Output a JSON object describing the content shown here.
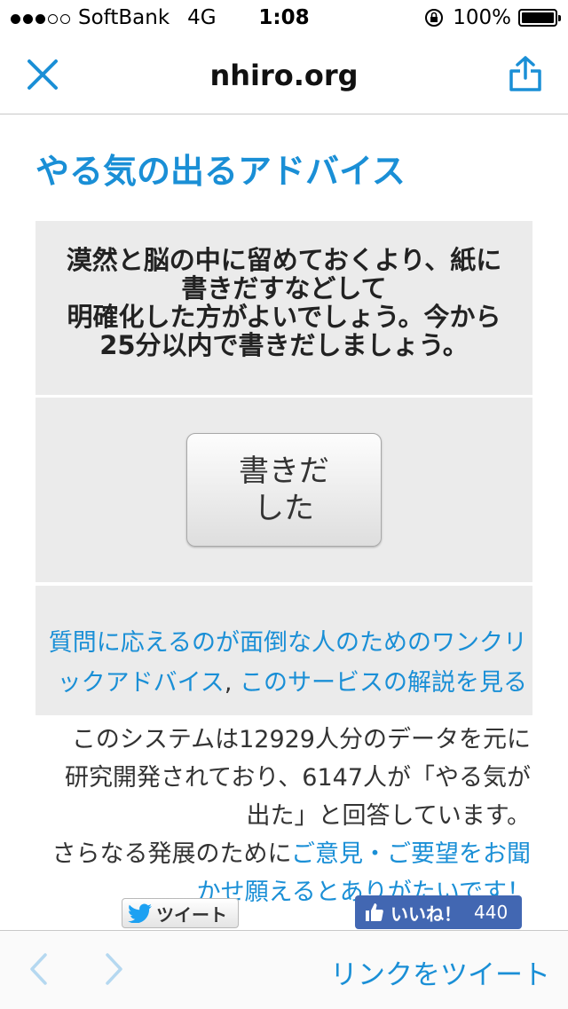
{
  "status_bar": {
    "carrier": "SoftBank",
    "network": "4G",
    "time": "1:08",
    "battery": "100%",
    "signal_bars_filled": 3,
    "signal_bars_total": 5
  },
  "nav": {
    "title": "nhiro.org",
    "close_icon": "close-icon",
    "share_icon": "share-icon"
  },
  "page": {
    "title": "やる気の出るアドバイス",
    "message_lines": [
      "漠然と脳の中に留めておくより、紙に",
      "書きだすなどして",
      "明確化した方がよいでしょう。今から",
      "25分以内で書きだしましょう。"
    ],
    "button_lines": [
      "書きだ",
      "した"
    ],
    "link_part1": "質問に応えるのが面倒な人のためのワンクリックアドバイス",
    "link_sep": ",",
    "link_part2": "このサービスの解説を見る",
    "info_lines": [
      "このシステムは12929人分のデータを元に",
      "研究開発されており、6147人が「やる気が",
      "出た」と回答しています。"
    ],
    "feedback_prefix": "さらなる発展のために",
    "feedback_link_lines": [
      "ご意見・ご要望をお聞",
      "かせ願えるとありがたいです！"
    ],
    "tweet_button": "ツイート",
    "like_button": "いいね！",
    "like_count": "440"
  },
  "toolbar": {
    "tweet_link": "リンクをツイート"
  },
  "colors": {
    "accent": "#1a8fd6",
    "panel_bg": "#ebebeb",
    "facebook": "#4267b2"
  }
}
